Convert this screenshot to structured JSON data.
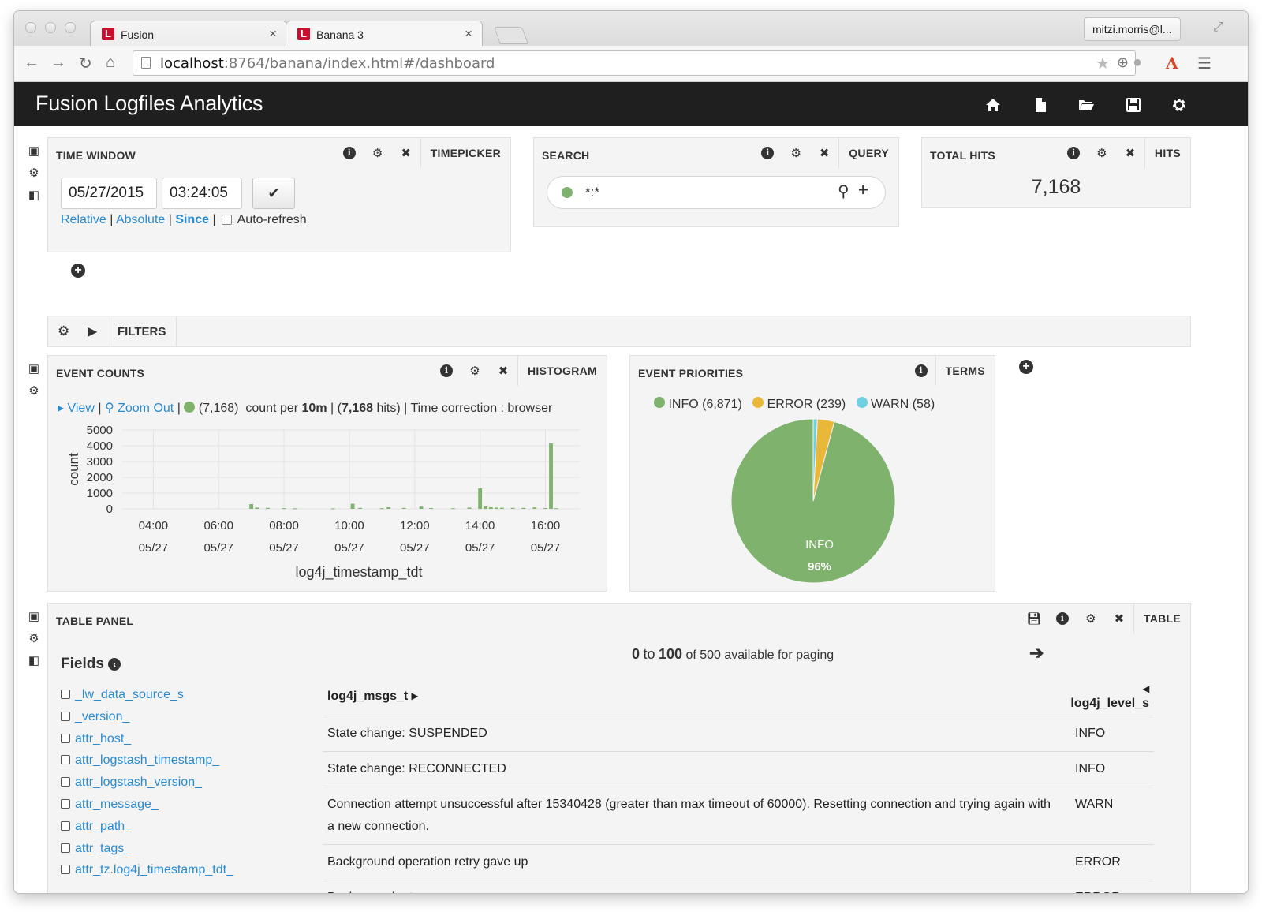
{
  "browser": {
    "tabs": [
      {
        "label": "Fusion",
        "favicon": "L"
      },
      {
        "label": "Banana 3",
        "favicon": "L"
      }
    ],
    "user": "mitzi.morris@l...",
    "url_host": "localhost",
    "url_path": ":8764/banana/index.html#/dashboard"
  },
  "app": {
    "title": "Fusion Logfiles Analytics"
  },
  "timewindow": {
    "title": "TIME WINDOW",
    "type": "TIMEPICKER",
    "date": "05/27/2015",
    "time": "03:24:05",
    "mode_relative": "Relative",
    "mode_absolute": "Absolute",
    "mode_since": "Since",
    "sep": "|",
    "autorefresh": "Auto-refresh"
  },
  "search": {
    "title": "SEARCH",
    "type": "QUERY",
    "query": "*:*"
  },
  "totalhits": {
    "title": "TOTAL HITS",
    "type": "HITS",
    "value": "7,168"
  },
  "filters": {
    "label": "FILTERS"
  },
  "eventcounts": {
    "title": "EVENT COUNTS",
    "type": "HISTOGRAM",
    "view": "View",
    "zoomout": "Zoom Out",
    "series_count": "(7,168)",
    "count_per": "count per",
    "interval": "10m",
    "hits_open": "| (",
    "hits_value": "7,168",
    "hits_close": "hits) | Time correction : browser",
    "sep": "|"
  },
  "eventpriorities": {
    "title": "EVENT PRIORITIES",
    "type": "TERMS",
    "legend": [
      {
        "label": "INFO (6,871)",
        "color": "#7eb26d"
      },
      {
        "label": "ERROR (239)",
        "color": "#eab839"
      },
      {
        "label": "WARN (58)",
        "color": "#6ed0e0"
      }
    ],
    "slice_label": "INFO",
    "slice_pct": "96%"
  },
  "chart_data": [
    {
      "type": "bar",
      "ylabel": "count",
      "xlabel": "log4j_timestamp_tdt",
      "ylim": [
        0,
        5000
      ],
      "yticks": [
        "0",
        "1000",
        "2000",
        "3000",
        "4000",
        "5000"
      ],
      "xticks": [
        {
          "hour": 4,
          "time": "04:00",
          "date": "05/27"
        },
        {
          "hour": 6,
          "time": "06:00",
          "date": "05/27"
        },
        {
          "hour": 8,
          "time": "08:00",
          "date": "05/27"
        },
        {
          "hour": 10,
          "time": "10:00",
          "date": "05/27"
        },
        {
          "hour": 12,
          "time": "12:00",
          "date": "05/27"
        },
        {
          "hour": 14,
          "time": "14:00",
          "date": "05/27"
        },
        {
          "hour": 16,
          "time": "16:00",
          "date": "05/27"
        }
      ],
      "series": [
        {
          "color": "#7eb26d",
          "points": [
            [
              7.0,
              300
            ],
            [
              7.17,
              80
            ],
            [
              7.5,
              60
            ],
            [
              8.0,
              40
            ],
            [
              8.33,
              30
            ],
            [
              9.5,
              30
            ],
            [
              10.1,
              320
            ],
            [
              10.33,
              60
            ],
            [
              11.0,
              40
            ],
            [
              11.2,
              100
            ],
            [
              11.67,
              60
            ],
            [
              12.2,
              140
            ],
            [
              12.5,
              50
            ],
            [
              13.17,
              40
            ],
            [
              13.67,
              80
            ],
            [
              14.0,
              1300
            ],
            [
              14.17,
              150
            ],
            [
              14.33,
              100
            ],
            [
              14.5,
              80
            ],
            [
              14.67,
              70
            ],
            [
              15.0,
              60
            ],
            [
              15.33,
              60
            ],
            [
              15.67,
              90
            ],
            [
              16.0,
              50
            ],
            [
              16.17,
              4150
            ],
            [
              16.33,
              40
            ]
          ]
        }
      ]
    },
    {
      "type": "pie",
      "categories": [
        "INFO",
        "ERROR",
        "WARN"
      ],
      "values": [
        6871,
        239,
        58
      ],
      "colors": [
        "#7eb26d",
        "#eab839",
        "#6ed0e0"
      ]
    }
  ],
  "table": {
    "title": "TABLE PANEL",
    "type": "TABLE",
    "fields_label": "Fields",
    "paging_from": "0",
    "paging_to_word": "to",
    "paging_to": "100",
    "paging_rest": "of 500 available for paging",
    "col_msg": "log4j_msgs_t",
    "col_level": "log4j_level_s",
    "fields": [
      "_lw_data_source_s",
      "_version_",
      "attr_host_",
      "attr_logstash_timestamp_",
      "attr_logstash_version_",
      "attr_message_",
      "attr_path_",
      "attr_tags_",
      "attr_tz.log4j_timestamp_tdt_"
    ],
    "rows": [
      {
        "msg": "State change: SUSPENDED",
        "level": "INFO"
      },
      {
        "msg": "State change: RECONNECTED",
        "level": "INFO"
      },
      {
        "msg": "Connection attempt unsuccessful after 15340428 (greater than max timeout of 60000). Resetting connection and trying again with a new connection.",
        "level": "WARN"
      },
      {
        "msg": "Background operation retry gave up",
        "level": "ERROR"
      },
      {
        "msg": "Background retry gave up",
        "level": "ERROR"
      }
    ]
  }
}
